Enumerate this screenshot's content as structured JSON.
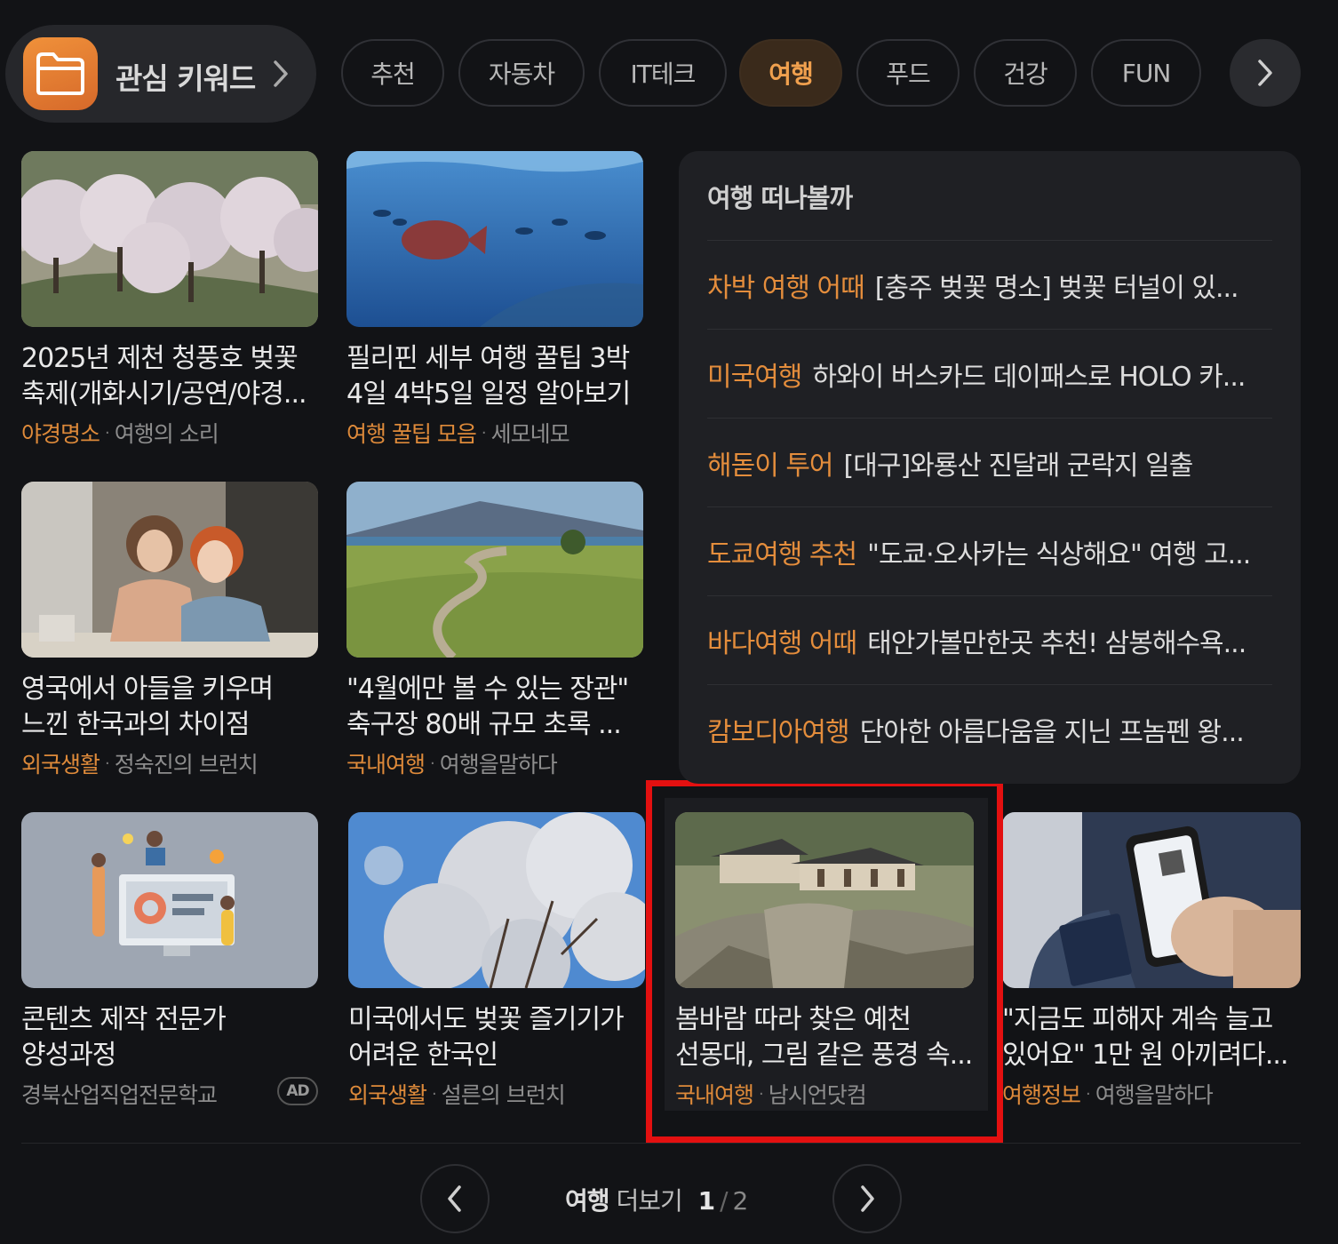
{
  "keyword_bar": {
    "label": "관심 키워드",
    "tabs": [
      "추천",
      "자동차",
      "IT테크",
      "여행",
      "푸드",
      "건강",
      "FUN"
    ],
    "active_tab": "여행"
  },
  "cards": [
    {
      "title": "2025년 제천 청풍호 벚꽃 축제(개화시기/공연/야경...",
      "category": "야경명소",
      "source": "여행의 소리"
    },
    {
      "title": "필리핀 세부 여행 꿀팁 3박 4일 4박5일 일정 알아보기",
      "category": "여행 꿀팁 모음",
      "source": "세모네모"
    },
    {
      "title": "영국에서 아들을 키우며 느낀 한국과의 차이점",
      "category": "외국생활",
      "source": "정숙진의 브런치"
    },
    {
      "title": "\"4월에만 볼 수 있는 장관\" 축구장 80배 규모 초록 ...",
      "category": "국내여행",
      "source": "여행을말하다"
    },
    {
      "title": "콘텐츠 제작 전문가 양성과정",
      "category": "",
      "source": "경북산업직업전문학교",
      "badge": "AD"
    },
    {
      "title": "미국에서도 벚꽃 즐기기가 어려운 한국인",
      "category": "외국생활",
      "source": "설른의 브런치"
    },
    {
      "title": "봄바람 따라 찾은 예천 선몽대, 그림 같은 풍경 속...",
      "category": "국내여행",
      "source": "남시언닷컴"
    },
    {
      "title": "\"지금도 피해자 계속 늘고 있어요\" 1만 원 아끼려다...",
      "category": "여행정보",
      "source": "여행을말하다"
    }
  ],
  "panel": {
    "title": "여행 떠나볼까",
    "items": [
      {
        "keyword": "차박 여행 어때",
        "text": "[충주 벚꽃 명소] 벚꽃 터널이 있..."
      },
      {
        "keyword": "미국여행",
        "text": "하와이 버스카드 데이패스로 HOLO 카..."
      },
      {
        "keyword": "해돋이 투어",
        "text": "[대구]와룡산 진달래 군락지 일출"
      },
      {
        "keyword": "도쿄여행 추천",
        "text": "\"도쿄·오사카는 식상해요\" 여행 고..."
      },
      {
        "keyword": "바다여행 어때",
        "text": "태안가볼만한곳 추천! 삼봉해수욕..."
      },
      {
        "keyword": "캄보디아여행",
        "text": "단아한 아름다움을 지닌 프놈펜 왕..."
      }
    ]
  },
  "pagination": {
    "category": "여행",
    "more_label": "더보기",
    "current": "1",
    "separator": "/",
    "total": "2"
  },
  "colors": {
    "background": "#121316",
    "accent": "#de8a3a",
    "highlight_box": "#e31010"
  }
}
